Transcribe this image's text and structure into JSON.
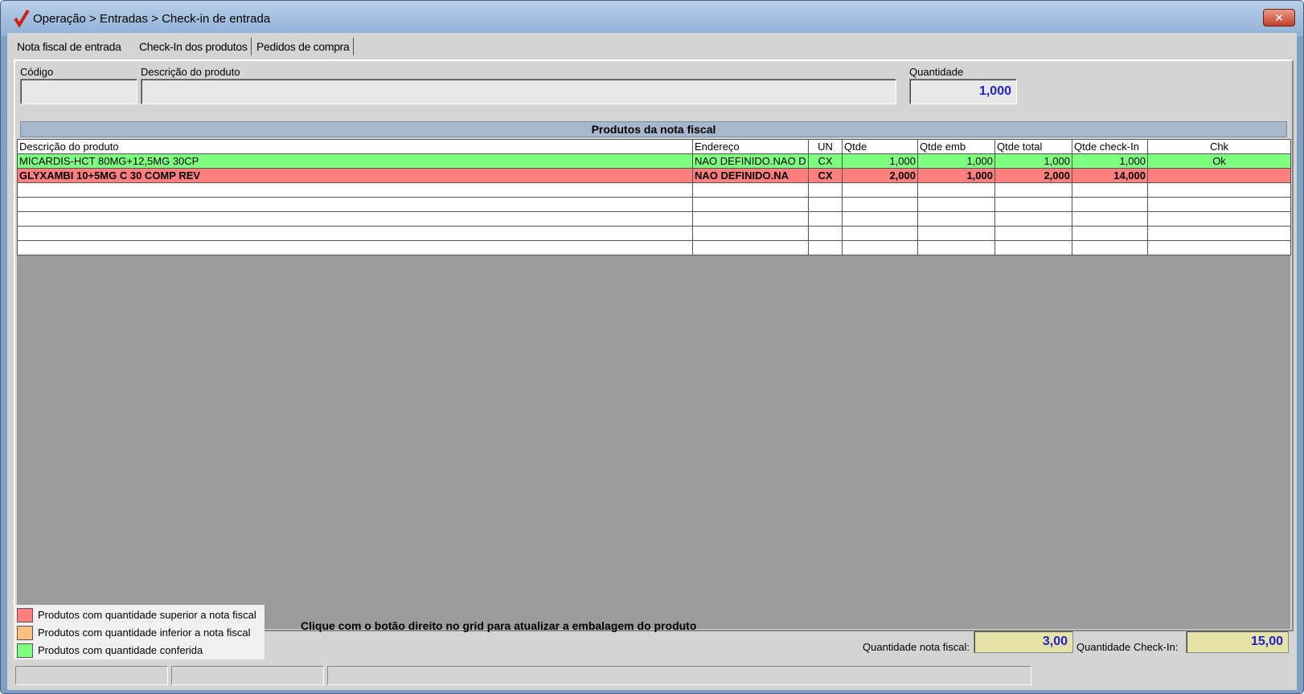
{
  "window": {
    "title": "Operação > Entradas > Check-in de entrada",
    "close_label": "✕"
  },
  "tabs": [
    {
      "label": "Nota fiscal de entrada"
    },
    {
      "label": "Check-In dos produtos"
    },
    {
      "label": "Pedidos de compra"
    }
  ],
  "form": {
    "codigo_label": "Código",
    "codigo_value": "",
    "descricao_label": "Descrição do produto",
    "descricao_value": "",
    "quantidade_label": "Quantidade",
    "quantidade_value": "1,000"
  },
  "section_title": "Produtos da nota fiscal",
  "grid": {
    "columns": [
      "Descrição do produto",
      "Endereço",
      "UN",
      "Qtde",
      "Qtde emb",
      "Qtde total",
      "Qtde check-In",
      "Chk"
    ],
    "rows": [
      {
        "status": "ok",
        "cells": [
          "MICARDIS-HCT 80MG+12,5MG 30CP",
          "NAO DEFINIDO.NAO D",
          "CX",
          "1,000",
          "1,000",
          "1,000",
          "1,000",
          "Ok"
        ]
      },
      {
        "status": "over",
        "cells": [
          "GLYXAMBI 10+5MG C 30 COMP REV",
          "NAO DEFINIDO.NA",
          "CX",
          "2,000",
          "1,000",
          "2,000",
          "14,000",
          ""
        ]
      }
    ]
  },
  "legend": [
    {
      "color": "#ff7f7f",
      "text": "Produtos com quantidade superior a nota fiscal"
    },
    {
      "color": "#ffbf7f",
      "text": "Produtos com quantidade inferior a nota fiscal"
    },
    {
      "color": "#7fff7f",
      "text": "Produtos com quantidade conferida"
    }
  ],
  "hint": "Clique com o botão direito no grid para atualizar a embalagem do produto",
  "totals": {
    "nota_fiscal_label": "Quantidade nota fiscal:",
    "nota_fiscal_value": "3,00",
    "checkin_label": "Quantidade Check-In:",
    "checkin_value": "15,00"
  },
  "colors": {
    "ok_row": "#7fff7f",
    "over_row": "#ff7f7f",
    "under_row": "#ffbf7f",
    "accent_text": "#2222cc"
  }
}
